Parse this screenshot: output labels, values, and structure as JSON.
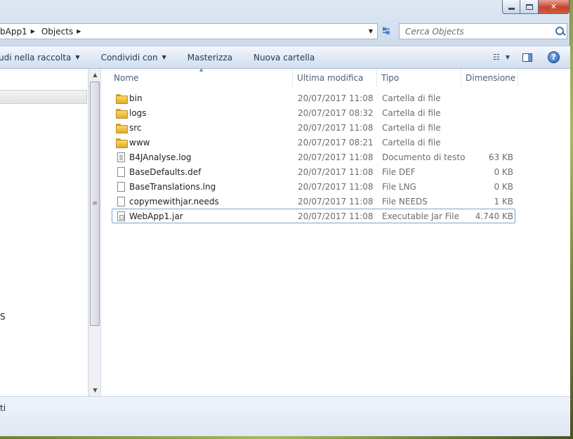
{
  "address": {
    "crumbs": [
      "bApp1",
      "Objects"
    ],
    "refresh_glyph": "↹"
  },
  "search": {
    "placeholder": "Cerca Objects"
  },
  "toolbar": {
    "include_label": "udi nella raccolta",
    "share_label": "Condividi con",
    "burn_label": "Masterizza",
    "new_folder_label": "Nuova cartella",
    "help_label": "?"
  },
  "columns": {
    "name": "Nome",
    "modified": "Ultima modifica",
    "type": "Tipo",
    "size": "Dimensione"
  },
  "files": [
    {
      "name": "bin",
      "modified": "20/07/2017 11:08",
      "type": "Cartella di file",
      "size": "",
      "icon": "folder-icon"
    },
    {
      "name": "logs",
      "modified": "20/07/2017 08:32",
      "type": "Cartella di file",
      "size": "",
      "icon": "folder-icon"
    },
    {
      "name": "src",
      "modified": "20/07/2017 11:08",
      "type": "Cartella di file",
      "size": "",
      "icon": "folder-icon"
    },
    {
      "name": "www",
      "modified": "20/07/2017 08:21",
      "type": "Cartella di file",
      "size": "",
      "icon": "folder-icon"
    },
    {
      "name": "B4JAnalyse.log",
      "modified": "20/07/2017 11:08",
      "type": "Documento di testo",
      "size": "63 KB",
      "icon": "text-file-icon"
    },
    {
      "name": "BaseDefaults.def",
      "modified": "20/07/2017 11:08",
      "type": "File DEF",
      "size": "0 KB",
      "icon": "file-icon"
    },
    {
      "name": "BaseTranslations.lng",
      "modified": "20/07/2017 11:08",
      "type": "File LNG",
      "size": "0 KB",
      "icon": "file-icon"
    },
    {
      "name": "copymewithjar.needs",
      "modified": "20/07/2017 11:08",
      "type": "File NEEDS",
      "size": "1 KB",
      "icon": "file-icon"
    },
    {
      "name": "WebApp1.jar",
      "modified": "20/07/2017 11:08",
      "type": "Executable Jar File",
      "size": "4.740 KB",
      "icon": "jar-file-icon",
      "selected": true
    }
  ],
  "nav": {
    "partial_text": "S"
  },
  "status": {
    "text": "ti"
  }
}
